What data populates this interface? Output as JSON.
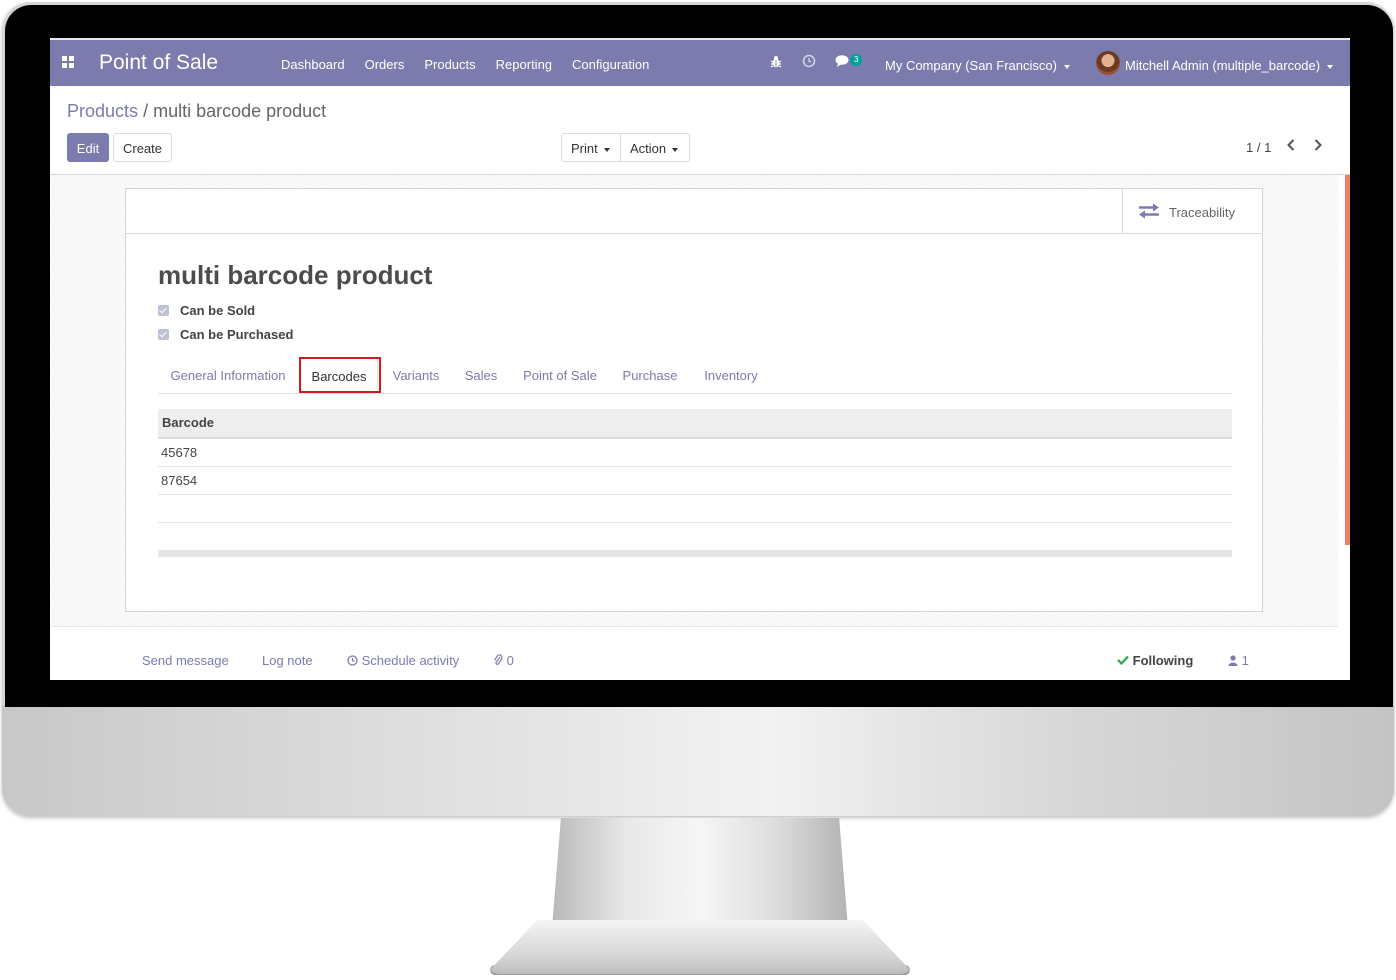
{
  "navbar": {
    "app_title": "Point of Sale",
    "menu": [
      "Dashboard",
      "Orders",
      "Products",
      "Reporting",
      "Configuration"
    ],
    "messages_badge": "3",
    "company": "My Company (San Francisco)",
    "user": "Mitchell Admin (multiple_barcode)",
    "color": "#7c7bad"
  },
  "breadcrumb": {
    "parent": "Products",
    "separator": "/",
    "current": "multi barcode product"
  },
  "buttons": {
    "edit": "Edit",
    "create": "Create",
    "print": "Print",
    "action": "Action"
  },
  "pager": {
    "value": "1 / 1"
  },
  "smart_button": {
    "label": "Traceability",
    "icon": "exchange-icon"
  },
  "product": {
    "name": "multi barcode product",
    "can_be_sold": {
      "label": "Can be Sold",
      "checked": true
    },
    "can_be_purchased": {
      "label": "Can be Purchased",
      "checked": true
    }
  },
  "tabs": [
    {
      "label": "General Information",
      "active": false
    },
    {
      "label": "Barcodes",
      "active": true
    },
    {
      "label": "Variants",
      "active": false
    },
    {
      "label": "Sales",
      "active": false
    },
    {
      "label": "Point of Sale",
      "active": false
    },
    {
      "label": "Purchase",
      "active": false
    },
    {
      "label": "Inventory",
      "active": false
    }
  ],
  "barcode_table": {
    "header": "Barcode",
    "rows": [
      "45678",
      "87654"
    ]
  },
  "chatter": {
    "send_message": "Send message",
    "log_note": "Log note",
    "schedule_activity": "Schedule activity",
    "attachments": "0",
    "following": "Following",
    "followers": "1"
  },
  "colors": {
    "accent": "#7c7bad",
    "highlight": "#cf1b1b",
    "teal_badge": "#00a09d"
  }
}
